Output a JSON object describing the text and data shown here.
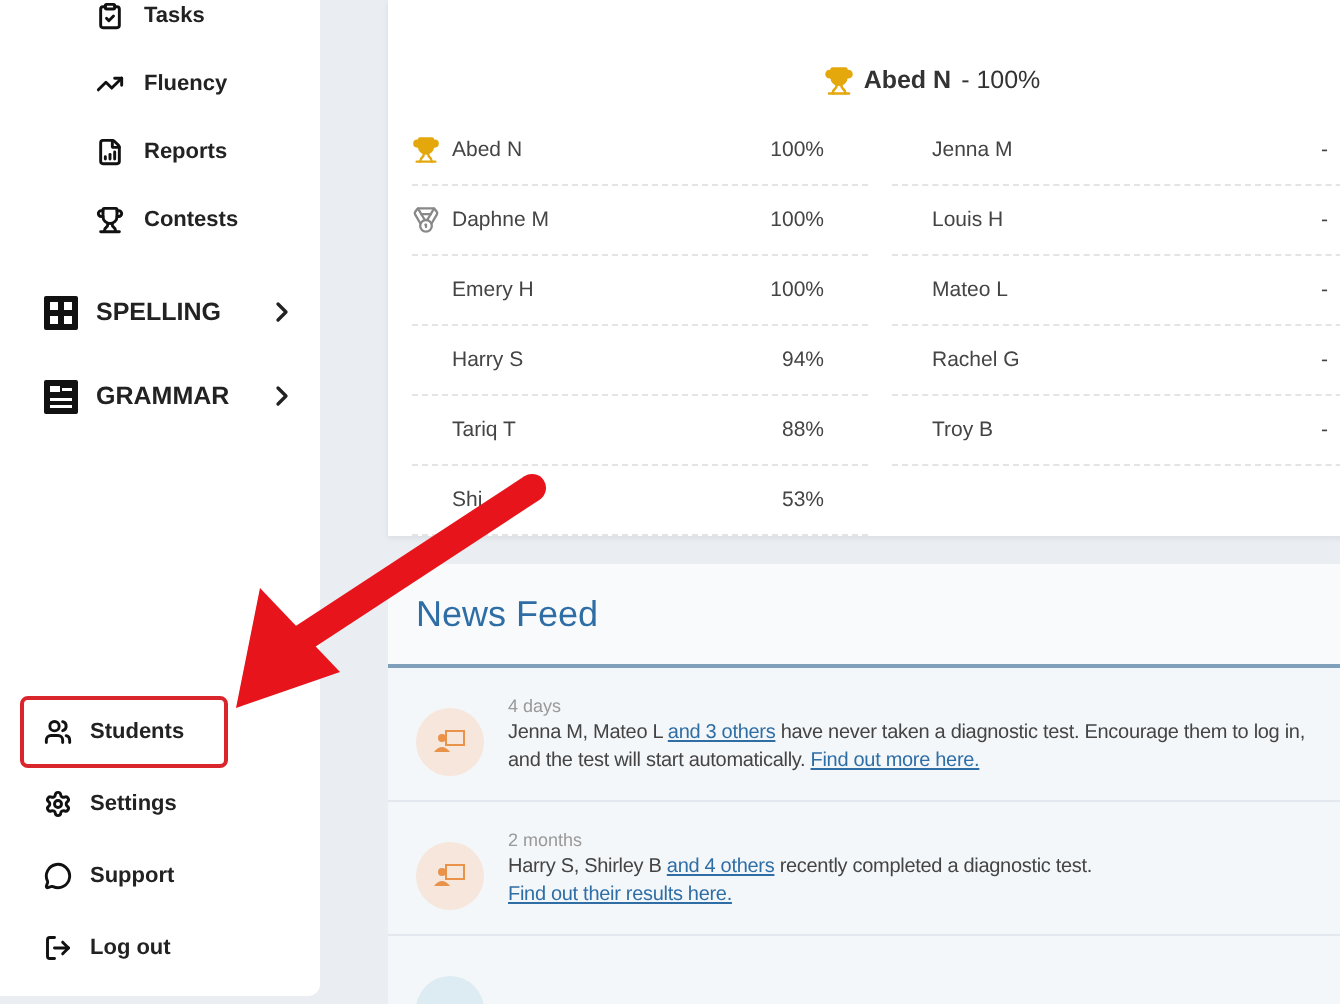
{
  "sidebar": {
    "sub_items": [
      {
        "label": "Tasks"
      },
      {
        "label": "Fluency"
      },
      {
        "label": "Reports"
      },
      {
        "label": "Contests"
      }
    ],
    "sections": [
      {
        "label": "SPELLING"
      },
      {
        "label": "GRAMMAR"
      }
    ],
    "bottom_items": [
      {
        "label": "Students",
        "highlighted": true
      },
      {
        "label": "Settings",
        "highlighted": false
      },
      {
        "label": "Support",
        "highlighted": false
      },
      {
        "label": "Log out",
        "highlighted": false
      }
    ]
  },
  "leaderboard": {
    "winner": {
      "name": "Abed N",
      "score": "- 100%"
    },
    "columns": [
      [
        {
          "name": "Abed N",
          "score": "100%",
          "kind": "gold"
        },
        {
          "name": "Daphne M",
          "score": "100%",
          "kind": "silver"
        },
        {
          "name": "Emery H",
          "score": "100%",
          "kind": "plain"
        },
        {
          "name": "Harry S",
          "score": "94%",
          "kind": "plain"
        },
        {
          "name": "Tariq T",
          "score": "88%",
          "kind": "plain"
        },
        {
          "name": "Shi",
          "score": "53%",
          "kind": "plain"
        }
      ],
      [
        {
          "name": "Jenna M",
          "score": "-",
          "kind": "plain"
        },
        {
          "name": "Louis H",
          "score": "-",
          "kind": "plain"
        },
        {
          "name": "Mateo L",
          "score": "-",
          "kind": "plain"
        },
        {
          "name": "Rachel G",
          "score": "-",
          "kind": "plain"
        },
        {
          "name": "Troy B",
          "score": "-",
          "kind": "plain"
        }
      ]
    ]
  },
  "news_feed": {
    "title": "News Feed",
    "items": [
      {
        "time": "4 days",
        "color": "#f6e6dc",
        "lines": [
          [
            {
              "kind": "text",
              "text": "Jenna M, Mateo L "
            },
            {
              "kind": "link",
              "text": "and 3 others"
            },
            {
              "kind": "text",
              "text": " have never taken a diagnostic test. Encourage them to log in,"
            }
          ],
          [
            {
              "kind": "text",
              "text": "and the test will start automatically. "
            },
            {
              "kind": "link",
              "text": "Find out more here."
            }
          ]
        ]
      },
      {
        "time": "2 months",
        "color": "#f6e6dc",
        "lines": [
          [
            {
              "kind": "text",
              "text": "Harry S, Shirley B "
            },
            {
              "kind": "link",
              "text": "and 4 others"
            },
            {
              "kind": "text",
              "text": " recently completed a diagnostic test."
            }
          ],
          [
            {
              "kind": "link",
              "text": "Find out their results here."
            }
          ]
        ]
      },
      {
        "color": "#dcecf2"
      }
    ]
  },
  "annotation": {
    "arrow": true
  }
}
